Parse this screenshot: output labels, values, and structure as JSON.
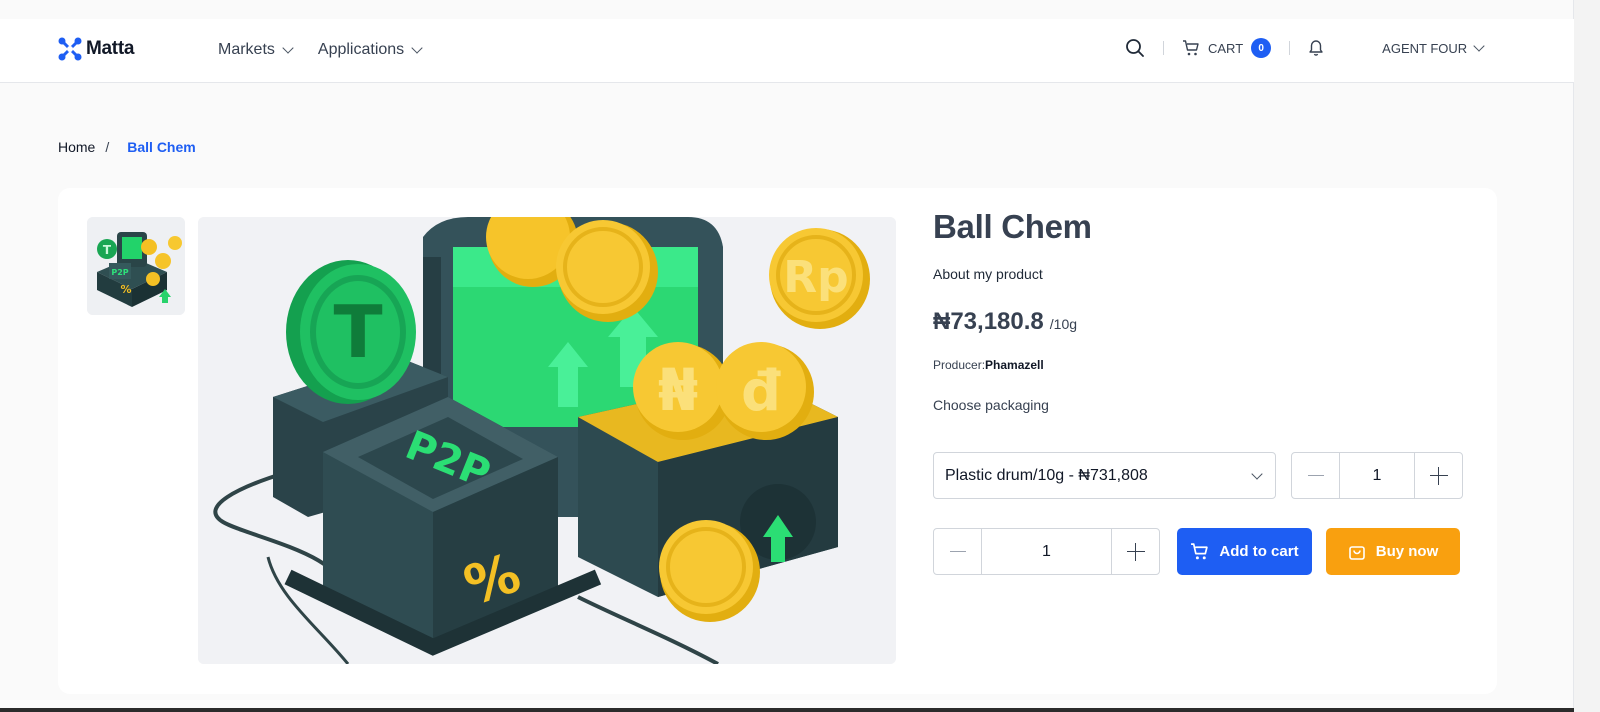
{
  "header": {
    "logo_text": "Matta",
    "nav": [
      {
        "label": "Markets"
      },
      {
        "label": "Applications"
      }
    ],
    "cart_label": "CART",
    "cart_count": "0",
    "user_name": "AGENT FOUR"
  },
  "breadcrumb": {
    "home": "Home",
    "separator": "/",
    "current": "Ball Chem"
  },
  "product": {
    "title": "Ball Chem",
    "about": "About my product",
    "price": "₦73,180.8",
    "unit": "/10g",
    "producer_label": "Producer:",
    "producer_name": "Phamazell",
    "choose_label": "Choose packaging",
    "packaging_selected": "Plastic drum/10g - ₦731,808",
    "packaging_qty": "1",
    "qty": "1",
    "add_to_cart": "Add to cart",
    "buy_now": "Buy now"
  },
  "colors": {
    "accent": "#1e5ef3",
    "buy": "#f9a00f"
  }
}
